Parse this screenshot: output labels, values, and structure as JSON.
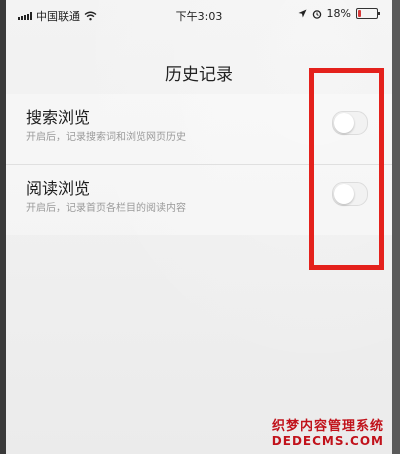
{
  "status_bar": {
    "carrier": "中国联通",
    "time": "下午3:03",
    "battery_text": "18%",
    "battery_level": 0.18
  },
  "page": {
    "title": "历史记录"
  },
  "settings": [
    {
      "title": "搜索浏览",
      "subtitle": "开启后，记录搜索词和浏览网页历史",
      "enabled": false
    },
    {
      "title": "阅读浏览",
      "subtitle": "开启后，记录首页各栏目的阅读内容",
      "enabled": false
    }
  ],
  "watermark": {
    "line1": "织梦内容管理系统",
    "line2": "DEDECMS.COM"
  },
  "colors": {
    "highlight": "#e4211c",
    "battery_low": "#d63a3a"
  },
  "icons": [
    "signal-icon",
    "wifi-icon",
    "location-icon",
    "alarm-icon",
    "battery-icon"
  ]
}
